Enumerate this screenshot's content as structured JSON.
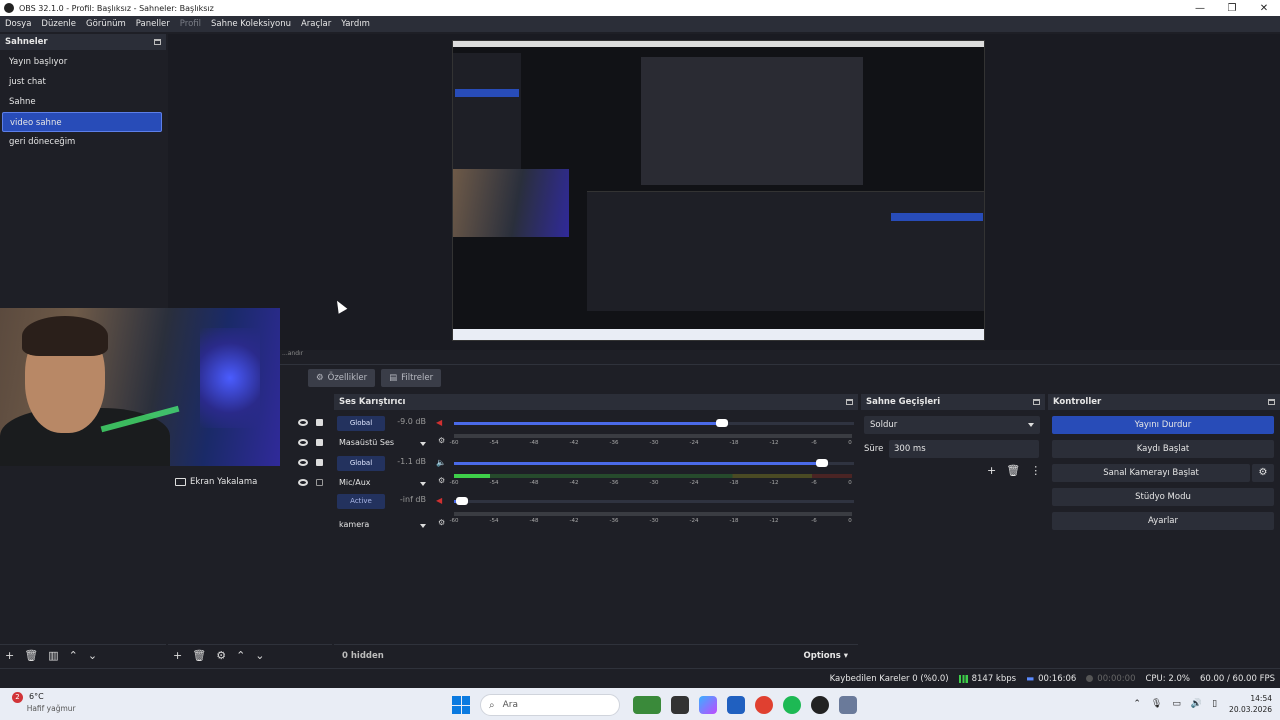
{
  "window": {
    "title": "OBS 32.1.0 - Profil: Başlıksız - Sahneler: Başlıksız",
    "controls": [
      "—",
      "❐",
      "✕"
    ]
  },
  "menu": {
    "items": [
      "Dosya",
      "Düzenle",
      "Görünüm",
      "Paneller",
      "Profil",
      "Sahne Koleksiyonu",
      "Araçlar",
      "Yardım"
    ]
  },
  "scenes": {
    "title": "Sahneler",
    "items": [
      "Yayın başlıyor",
      "just chat",
      "Sahne",
      "video sahne",
      "geri döneceğim"
    ],
    "selected_index": 3
  },
  "preview": {
    "label": "...andır"
  },
  "toolbar": {
    "properties": "Özellikler",
    "filters": "Filtreler"
  },
  "sources": {
    "items": [
      "Ekran Yakalama"
    ]
  },
  "mixer": {
    "title": "Ses Karıştırıcı",
    "ticks": [
      "-60",
      "-54",
      "-48",
      "-42",
      "-36",
      "-30",
      "-24",
      "-18",
      "-12",
      "-6",
      "0"
    ],
    "channels": [
      {
        "chip": "Global",
        "db": "-9.0 dB",
        "name": "Masaüstü Ses",
        "volume": 0.67,
        "level": 0.0,
        "muted": true
      },
      {
        "chip": "Global",
        "db": "-1.1 dB",
        "name": "Mic/Aux",
        "volume": 0.92,
        "level": 0.09,
        "muted": false
      },
      {
        "chip": "Active",
        "db": "-inf dB",
        "name": "kamera",
        "volume": 0.02,
        "level": 0.0,
        "muted": true
      }
    ],
    "hidden": "0 hidden",
    "options": "Options"
  },
  "transitions": {
    "title": "Sahne Geçişleri",
    "selected": "Soldur",
    "duration_label": "Süre",
    "duration": "300 ms"
  },
  "controls": {
    "title": "Kontroller",
    "stop_stream": "Yayını Durdur",
    "start_record": "Kaydı Başlat",
    "start_virtualcam": "Sanal Kamerayı Başlat",
    "studio_mode": "Stüdyo Modu",
    "settings": "Ayarlar"
  },
  "status": {
    "dropped": "Kaybedilen Kareler 0 (%0.0)",
    "bitrate": "8147 kbps",
    "stream_time": "00:16:06",
    "rec_time": "00:00:00",
    "cpu": "CPU: 2.0%",
    "fps": "60.00 / 60.00 FPS"
  },
  "taskbar": {
    "weather_badge": "2",
    "temp": "6°C",
    "weather": "Hafif yağmur",
    "search": "Ara",
    "time": "14:54",
    "date": "20.03.2026"
  }
}
